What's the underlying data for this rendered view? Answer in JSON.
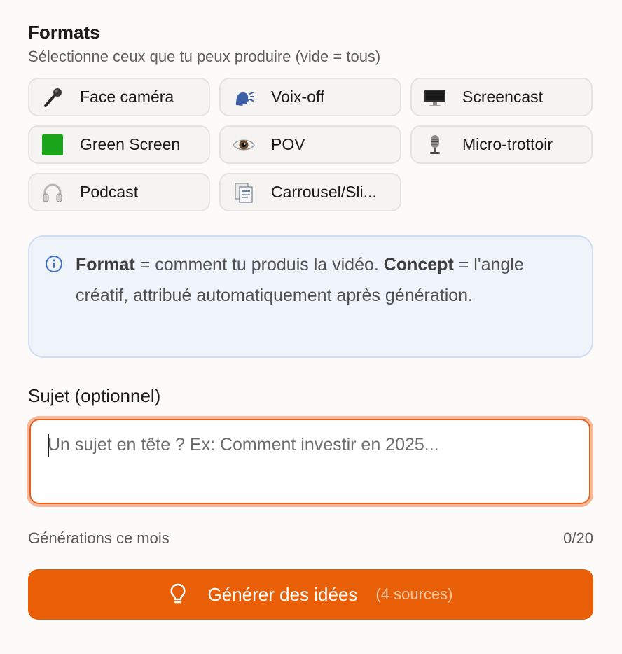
{
  "formats": {
    "title": "Formats",
    "subtitle": "Sélectionne ceux que tu peux produire (vide = tous)",
    "items": [
      {
        "label": "Face caméra",
        "icon": "microphone-icon"
      },
      {
        "label": "Voix-off",
        "icon": "speaking-head-icon"
      },
      {
        "label": "Screencast",
        "icon": "desktop-computer-icon"
      },
      {
        "label": "Green Screen",
        "icon": "green-square-icon"
      },
      {
        "label": "POV",
        "icon": "eye-icon"
      },
      {
        "label": "Micro-trottoir",
        "icon": "studio-microphone-icon"
      },
      {
        "label": "Podcast",
        "icon": "headphones-icon"
      },
      {
        "label": "Carrousel/Sli...",
        "icon": "slides-icon"
      }
    ]
  },
  "info": {
    "term1": "Format",
    "text1": " = comment tu produis la vidéo. ",
    "term2": "Concept",
    "text2": " = l'angle créatif, attribué automatiquement après génération."
  },
  "subject": {
    "title": "Sujet (optionnel)",
    "placeholder": "Un sujet en tête ? Ex: Comment investir en 2025..."
  },
  "generations": {
    "label": "Générations ce mois",
    "count": "0/20"
  },
  "cta": {
    "label": "Générer des idées",
    "meta": "(4 sources)"
  },
  "colors": {
    "accent": "#e85f07",
    "info_bg": "#eff3fa",
    "focus_ring": "#f5b89a"
  }
}
